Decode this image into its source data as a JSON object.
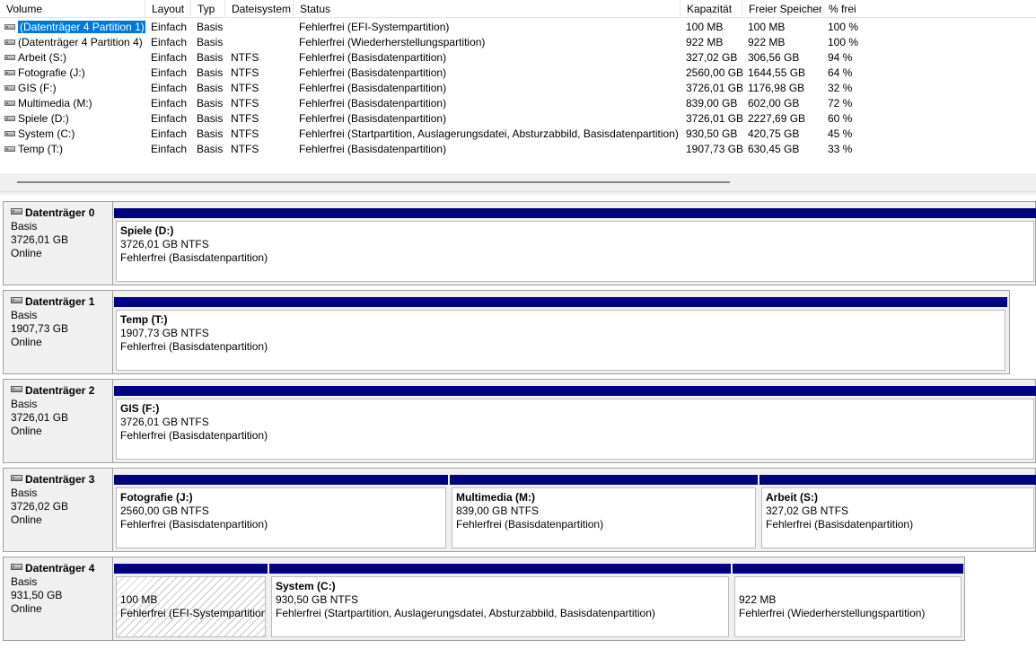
{
  "columns": [
    "Volume",
    "Layout",
    "Typ",
    "Dateisystem",
    "Status",
    "Kapazität",
    "Freier Speicher",
    "% frei"
  ],
  "volumes": [
    {
      "name": "(Datenträger 4 Partition 1)",
      "layout": "Einfach",
      "typ": "Basis",
      "fs": "",
      "status": "Fehlerfrei (EFI-Systempartition)",
      "capacity": "100 MB",
      "free": "100 MB",
      "pct": "100 %",
      "selected": true
    },
    {
      "name": "(Datenträger 4 Partition 4)",
      "layout": "Einfach",
      "typ": "Basis",
      "fs": "",
      "status": "Fehlerfrei (Wiederherstellungspartition)",
      "capacity": "922 MB",
      "free": "922 MB",
      "pct": "100 %"
    },
    {
      "name": "Arbeit (S:)",
      "layout": "Einfach",
      "typ": "Basis",
      "fs": "NTFS",
      "status": "Fehlerfrei (Basisdatenpartition)",
      "capacity": "327,02 GB",
      "free": "306,56 GB",
      "pct": "94 %"
    },
    {
      "name": "Fotografie (J:)",
      "layout": "Einfach",
      "typ": "Basis",
      "fs": "NTFS",
      "status": "Fehlerfrei (Basisdatenpartition)",
      "capacity": "2560,00 GB",
      "free": "1644,55 GB",
      "pct": "64 %"
    },
    {
      "name": "GIS (F:)",
      "layout": "Einfach",
      "typ": "Basis",
      "fs": "NTFS",
      "status": "Fehlerfrei (Basisdatenpartition)",
      "capacity": "3726,01 GB",
      "free": "1176,98 GB",
      "pct": "32 %"
    },
    {
      "name": "Multimedia (M:)",
      "layout": "Einfach",
      "typ": "Basis",
      "fs": "NTFS",
      "status": "Fehlerfrei (Basisdatenpartition)",
      "capacity": "839,00 GB",
      "free": "602,00 GB",
      "pct": "72 %"
    },
    {
      "name": "Spiele (D:)",
      "layout": "Einfach",
      "typ": "Basis",
      "fs": "NTFS",
      "status": "Fehlerfrei (Basisdatenpartition)",
      "capacity": "3726,01 GB",
      "free": "2227,69 GB",
      "pct": "60 %"
    },
    {
      "name": "System (C:)",
      "layout": "Einfach",
      "typ": "Basis",
      "fs": "NTFS",
      "status": "Fehlerfrei (Startpartition, Auslagerungsdatei, Absturzabbild, Basisdatenpartition)",
      "capacity": "930,50 GB",
      "free": "420,75 GB",
      "pct": "45 %"
    },
    {
      "name": "Temp (T:)",
      "layout": "Einfach",
      "typ": "Basis",
      "fs": "NTFS",
      "status": "Fehlerfrei (Basisdatenpartition)",
      "capacity": "1907,73 GB",
      "free": "630,45 GB",
      "pct": "33 %"
    }
  ],
  "disks": [
    {
      "name": "Datenträger 0",
      "type": "Basis",
      "size": "3726,01 GB",
      "state": "Online",
      "partitions": [
        {
          "name": "Spiele  (D:)",
          "size": "3726,01 GB NTFS",
          "status": "Fehlerfrei (Basisdatenpartition)"
        }
      ]
    },
    {
      "name": "Datenträger 1",
      "type": "Basis",
      "size": "1907,73 GB",
      "state": "Online",
      "partitions": [
        {
          "name": "Temp  (T:)",
          "size": "1907,73 GB NTFS",
          "status": "Fehlerfrei (Basisdatenpartition)"
        }
      ]
    },
    {
      "name": "Datenträger 2",
      "type": "Basis",
      "size": "3726,01 GB",
      "state": "Online",
      "partitions": [
        {
          "name": "GIS  (F:)",
          "size": "3726,01 GB NTFS",
          "status": "Fehlerfrei (Basisdatenpartition)"
        }
      ]
    },
    {
      "name": "Datenträger 3",
      "type": "Basis",
      "size": "3726,02 GB",
      "state": "Online",
      "partitions": [
        {
          "name": "Fotografie  (J:)",
          "size": "2560,00 GB NTFS",
          "status": "Fehlerfrei (Basisdatenpartition)"
        },
        {
          "name": "Multimedia  (M:)",
          "size": "839,00 GB NTFS",
          "status": "Fehlerfrei (Basisdatenpartition)"
        },
        {
          "name": "Arbeit  (S:)",
          "size": "327,02 GB NTFS",
          "status": "Fehlerfrei (Basisdatenpartition)"
        }
      ]
    },
    {
      "name": "Datenträger 4",
      "type": "Basis",
      "size": "931,50 GB",
      "state": "Online",
      "partitions": [
        {
          "name": "",
          "size": "100 MB",
          "status": "Fehlerfrei (EFI-Systempartition)",
          "selected": true
        },
        {
          "name": "System  (C:)",
          "size": "930,50 GB NTFS",
          "status": "Fehlerfrei (Startpartition, Auslagerungsdatei, Absturzabbild, Basisdatenpartition)"
        },
        {
          "name": "",
          "size": "922 MB",
          "status": "Fehlerfrei (Wiederherstellungspartition)"
        }
      ]
    }
  ],
  "colors": {
    "partition_bar": "#000080",
    "selection": "#0078d7",
    "panel_bg": "#f0f0f0"
  }
}
